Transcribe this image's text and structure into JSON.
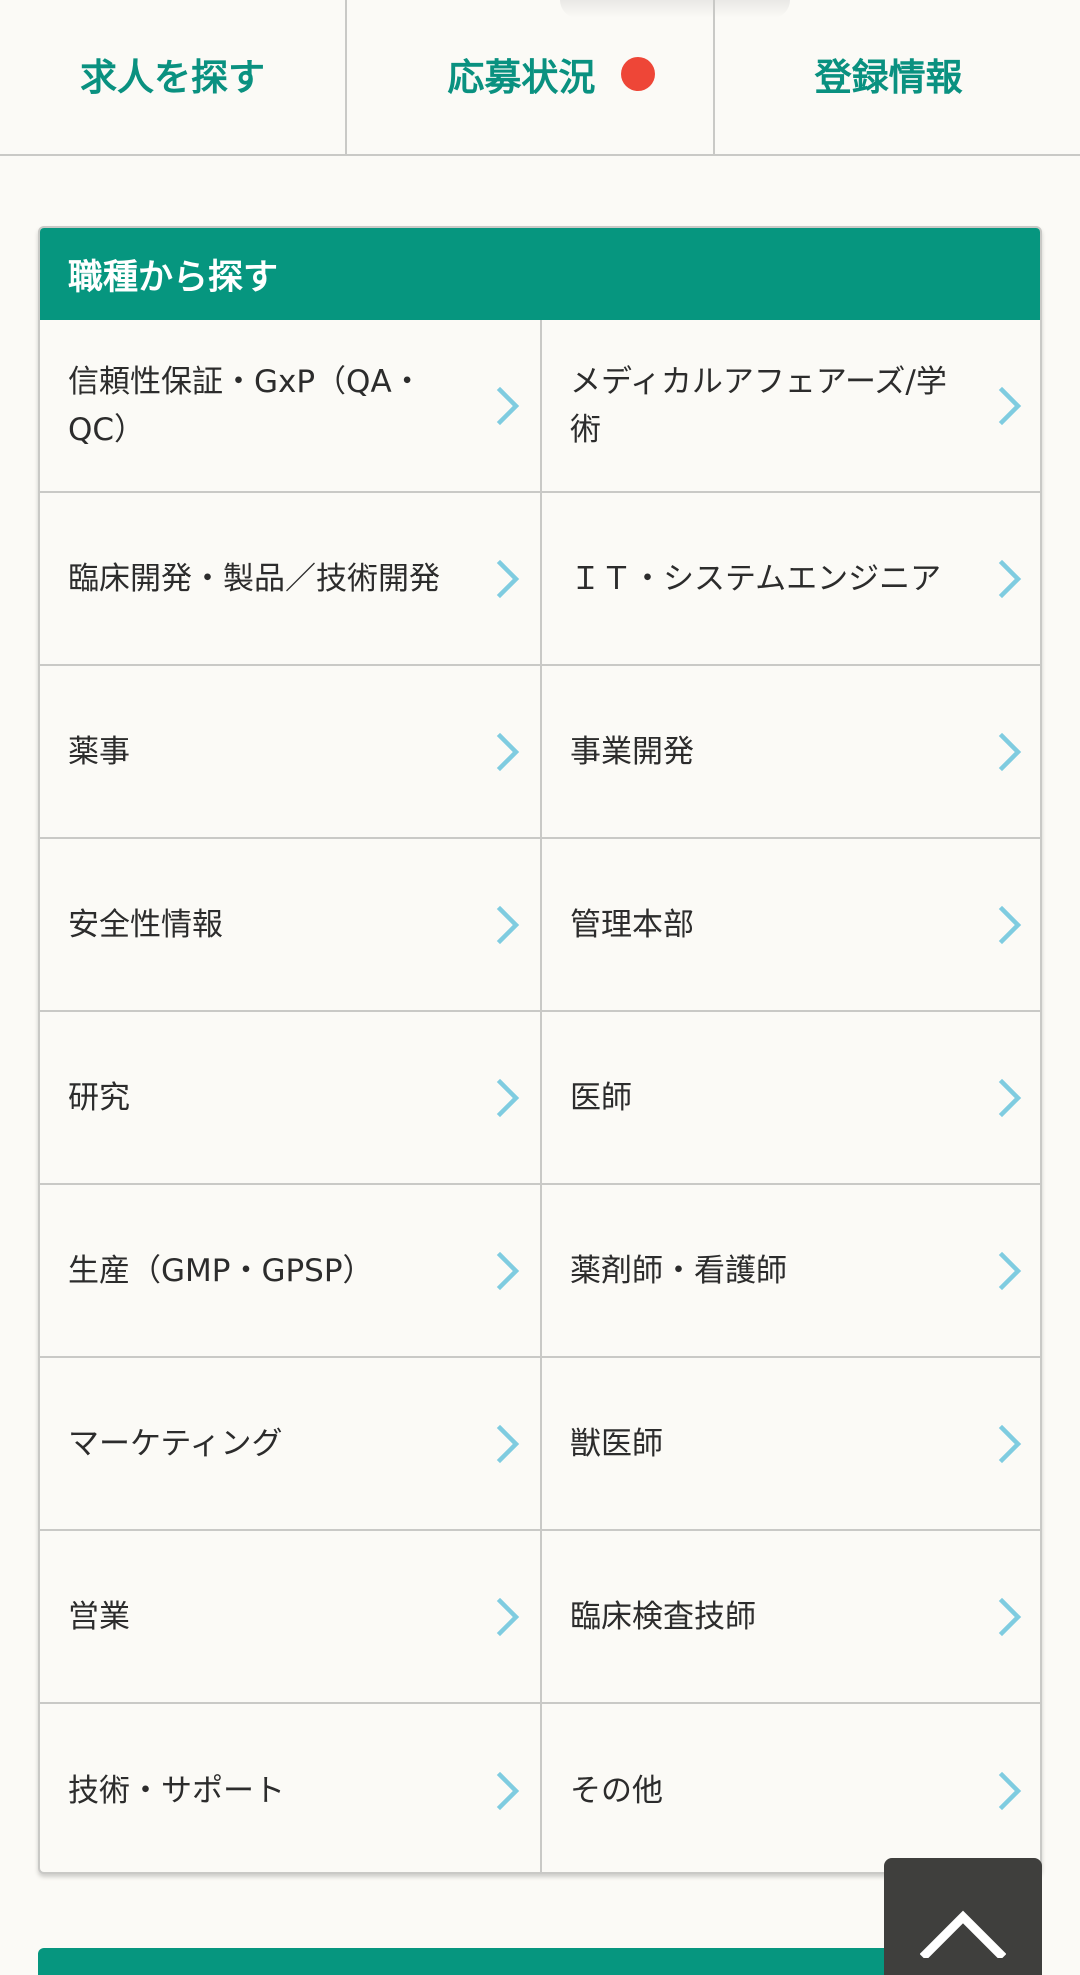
{
  "nav": {
    "tabs": [
      {
        "label": "求人を探す"
      },
      {
        "label": "応募状況",
        "has_notification": true
      },
      {
        "label": "登録情報"
      }
    ],
    "notification_color": "#ee4637"
  },
  "job_category": {
    "title": "職種から探す",
    "items": [
      {
        "label": "信頼性保証・GxP（QA・QC）"
      },
      {
        "label": "メディカルアフェアーズ/学術"
      },
      {
        "label": "臨床開発・製品／技術開発"
      },
      {
        "label": "ＩＴ・システムエンジニア"
      },
      {
        "label": "薬事"
      },
      {
        "label": "事業開発"
      },
      {
        "label": "安全性情報"
      },
      {
        "label": "管理本部"
      },
      {
        "label": "研究"
      },
      {
        "label": "医師"
      },
      {
        "label": "生産（GMP・GPSP）"
      },
      {
        "label": "薬剤師・看護師"
      },
      {
        "label": "マーケティング"
      },
      {
        "label": "獣医師"
      },
      {
        "label": "営業"
      },
      {
        "label": "臨床検査技師"
      },
      {
        "label": "技術・サポート"
      },
      {
        "label": "その他"
      }
    ]
  },
  "colors": {
    "accent": "#06967f",
    "nav_text": "#0a9180",
    "chevron": "#7fcce0",
    "back_to_top_bg": "#3f3f3d"
  },
  "icons": {
    "item_chevron": "chevron-right-icon",
    "back_to_top": "chevron-up-icon"
  }
}
